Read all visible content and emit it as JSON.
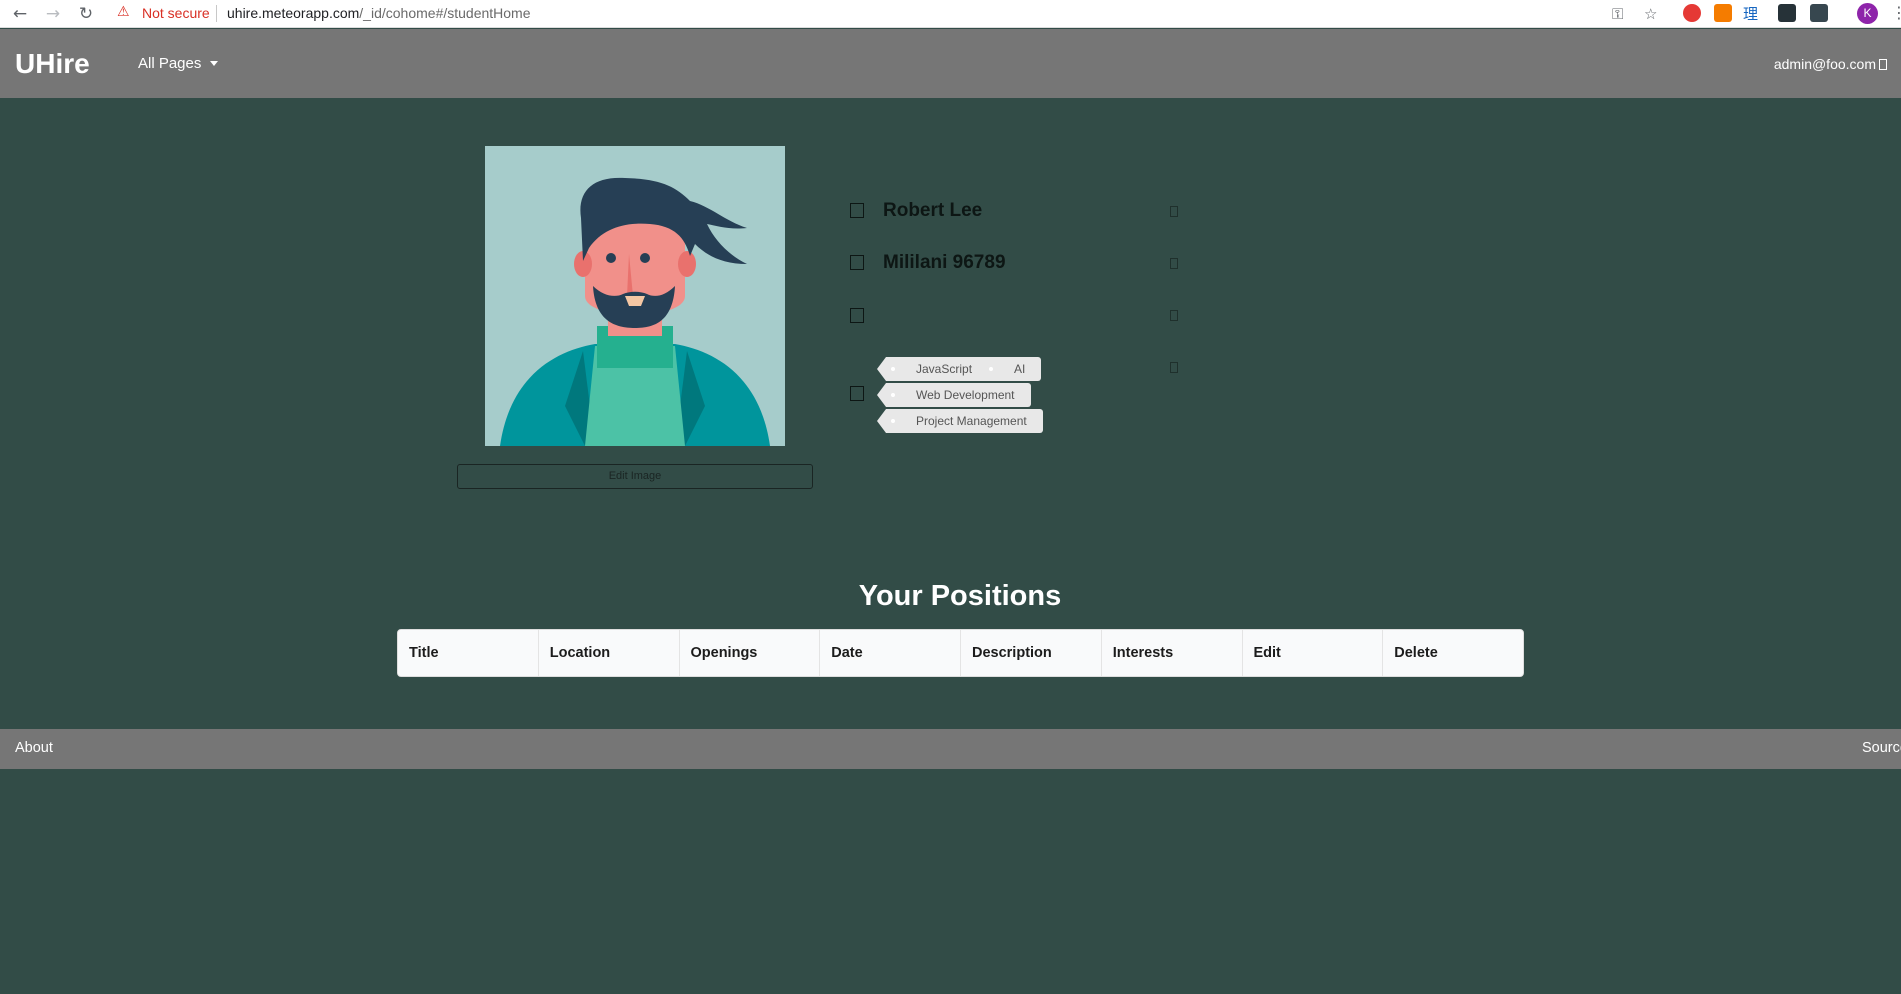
{
  "browser": {
    "security_label": "Not secure",
    "url_host": "uhire.meteorapp.com",
    "url_path": "/_id/cohome#/studentHome",
    "profile_initial": "K"
  },
  "navbar": {
    "brand": "UHire",
    "menu_label": "All Pages",
    "user_email": "admin@foo.com"
  },
  "profile": {
    "edit_image_label": "Edit Image",
    "name": "Robert Lee",
    "location": "Mililani 96789",
    "third_field": "",
    "interests": [
      "JavaScript",
      "AI",
      "Web Development",
      "Project Management"
    ]
  },
  "positions": {
    "title": "Your Positions",
    "columns": [
      "Title",
      "Location",
      "Openings",
      "Date",
      "Description",
      "Interests",
      "Edit",
      "Delete"
    ]
  },
  "footer": {
    "about": "About",
    "source": "Source"
  },
  "colors": {
    "page_bg": "#324c47",
    "navbar_bg": "#767676",
    "tag_bg": "#e8e8e8",
    "warning_red": "#d93025"
  }
}
